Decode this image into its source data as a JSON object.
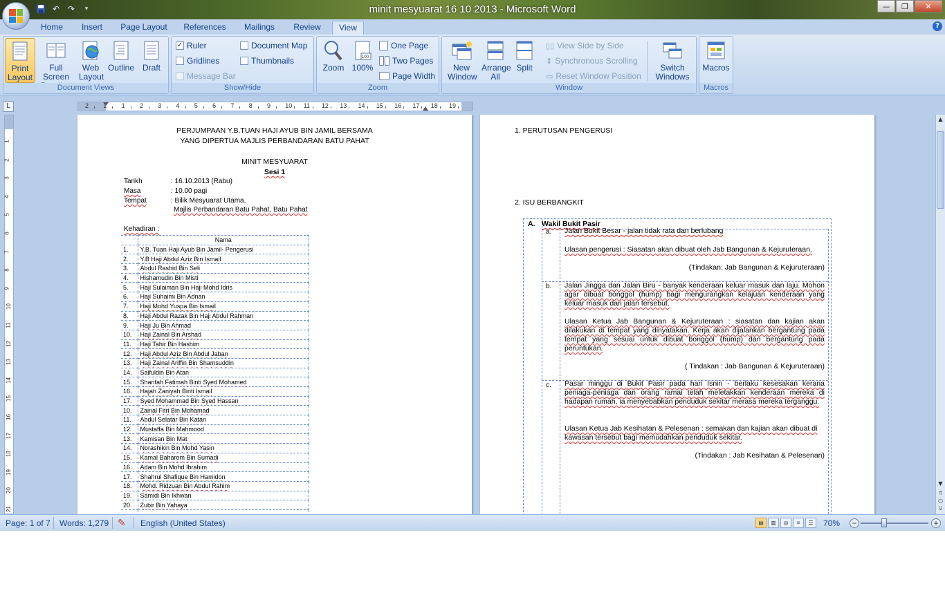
{
  "window": {
    "title": "minit mesyuarat 16 10 2013 - Microsoft Word"
  },
  "quick_access": {
    "save_icon": "save-icon",
    "undo_icon": "undo-icon",
    "redo_icon": "redo-icon",
    "customize_icon": "chevron-down-icon"
  },
  "tabs": [
    {
      "label": "Home"
    },
    {
      "label": "Insert"
    },
    {
      "label": "Page Layout"
    },
    {
      "label": "References"
    },
    {
      "label": "Mailings"
    },
    {
      "label": "Review"
    },
    {
      "label": "View",
      "active": true
    }
  ],
  "ribbon": {
    "document_views": {
      "label": "Document Views",
      "print_layout": "Print Layout",
      "full_screen_reading": "Full Screen Reading",
      "web_layout": "Web Layout",
      "outline": "Outline",
      "draft": "Draft"
    },
    "show_hide": {
      "label": "Show/Hide",
      "ruler": "Ruler",
      "ruler_checked": true,
      "gridlines": "Gridlines",
      "gridlines_checked": false,
      "message_bar": "Message Bar",
      "message_bar_enabled": false,
      "document_map": "Document Map",
      "document_map_checked": false,
      "thumbnails": "Thumbnails",
      "thumbnails_checked": false
    },
    "zoom": {
      "label": "Zoom",
      "zoom": "Zoom",
      "hundred": "100%",
      "one_page": "One Page",
      "two_pages": "Two Pages",
      "page_width": "Page Width"
    },
    "window": {
      "label": "Window",
      "new_window": "New Window",
      "arrange_all": "Arrange All",
      "split": "Split",
      "view_side_by_side": "View Side by Side",
      "synchronous_scrolling": "Synchronous Scrolling",
      "reset_window_position": "Reset Window Position",
      "switch_windows": "Switch Windows"
    },
    "macros": {
      "label": "Macros",
      "macros": "Macros"
    }
  },
  "ruler": {
    "numbers": [
      "2",
      "1",
      "1",
      "2",
      "3",
      "4",
      "5",
      "6",
      "7",
      "8",
      "9",
      "10",
      "11",
      "12",
      "13",
      "14",
      "15",
      "16",
      "17",
      "18",
      "19"
    ],
    "vertical_numbers": [
      "1",
      "2",
      "3",
      "4",
      "5",
      "6",
      "7",
      "8",
      "9",
      "10",
      "11",
      "12",
      "13",
      "14",
      "15",
      "16",
      "17",
      "18",
      "19",
      "20",
      "21"
    ]
  },
  "page1": {
    "heading1": "PERJUMPAAN Y.B.TUAN HAJI AYUB BIN JAMIL BERSAMA",
    "heading2": "YANG DIPERTUA  MAJLIS PERBANDARAN BATU PAHAT",
    "title": "MINIT MESYUARAT",
    "session": "Sesi 1",
    "tarikh_label": "Tarikh",
    "tarikh_value": ": 16.10.2013  (Rabu)",
    "masa_label": "Masa",
    "masa_value": ": 10.00 pagi",
    "tempat_label": "Tempat",
    "tempat_value1": ": Bilik Mesyuarat  Utama,",
    "tempat_value2": "Majlis Perbandaran Batu Pahat, Batu Pahat",
    "kehadiran_label": "Kehadiran :",
    "table_header": "Nama",
    "attendees": [
      [
        "1.",
        "Y.B. Tuan Haji Ayub Bin Jamil-  Pengerusi"
      ],
      [
        "2.",
        "Y.B Haji Abdul Aziz Bin Ismail"
      ],
      [
        "3.",
        "Abdul Rashid Bin Seli"
      ],
      [
        "4.",
        "Hishamudin Bin Misti"
      ],
      [
        "5.",
        "Haji Sulaiman Bin Haji Mohd Idris"
      ],
      [
        "6.",
        "Haji Suhaimi Bin Adnan"
      ],
      [
        "7.",
        "Haji Mohd Yuspa Bin Ismail"
      ],
      [
        "8.",
        "Haji Abdul Razak Bin Haji Abdul Rahman"
      ],
      [
        "9.",
        "Haji Ju Bin Ahmad"
      ],
      [
        "10.",
        "Haji Zainal Bin Arshad"
      ],
      [
        "11.",
        "Haji Tahir Bin Hashim"
      ],
      [
        "12.",
        "Haji Abdul Aziz Bin Abdul Jaban"
      ],
      [
        "13.",
        "Haji Zainal Ariffin Bin Shamsuddin"
      ],
      [
        "14.",
        "Saifuldin Bin Atan"
      ],
      [
        "15.",
        "Sharifah Fatimah  Binti Syed Mohamed"
      ],
      [
        "16.",
        "Hajah Zaniyah Binti Ismail"
      ],
      [
        "17.",
        "Syed Mohammad  Bin Syed Hassan"
      ],
      [
        "10.",
        "Zainal Fitri Bin Mohamad"
      ],
      [
        "11.",
        "Abdul Selatar Bin Katan"
      ],
      [
        "12.",
        "Mustaffa Bin Mahmood"
      ],
      [
        "13.",
        "Kamisan Bin Mat"
      ],
      [
        "14.",
        "Norashikin Bin Mohd Yasin"
      ],
      [
        "15.",
        "Kamal Baharom Bin Sumadi"
      ],
      [
        "16.",
        "Adam Bin Mohd Ibrahim"
      ],
      [
        "17.",
        "Shahrul Shafique Bin Hamidon"
      ],
      [
        "18.",
        "Mohd. Ridzuan Bin Abdul Rahim"
      ],
      [
        "19.",
        "Samidi Bin Ikhwan"
      ],
      [
        "20.",
        "Zubir Bin Yahaya"
      ],
      [
        "",
        ""
      ]
    ]
  },
  "page2": {
    "section1": "1.   PERUTUSAN PENGERUSI",
    "section2": "2.   ISU BERBANGKIT",
    "item_a_label": "A.",
    "item_a_title": "Wakil Bukit Pasir",
    "sub_a": "a.",
    "sub_a_text": "Jalan Bukit Besar - jalan tidak rata  dan berlubang",
    "sub_a_ulasan": "Ulasan pengerusi : Siasatan akan dibuat oleh Jab Bangunan & Kejuruteraan.",
    "sub_a_tindakan": "(Tindakan: Jab Bangunan & Kejuruteraan)",
    "sub_b": "b.",
    "sub_b_text": "Jalan Jingga dan Jalan Biru - banyak kenderaan keluar masuk dan laju. Mohon agar dibuat bonggol (hump) bagi mengurangkan kelajuan kenderaan yang keluar masuk dari jalan tersebut.",
    "sub_b_ulasan": "Ulasan Ketua Jab Bangunan & Kejuruteraan : siasatan dan kajian akan dilakukan di tempat yang dinyatakan.  Kerja akan dijalankan bergantung pada tempat yang sesuai untuk dibuat bonggol (hump) dan bergantung pada peruntukan.",
    "sub_b_tindakan": "( Tindakan : Jab Bangunan & Kejuruteraan)",
    "sub_c": "c.",
    "sub_c_text": "Pasar minggu di Bukit Pasir pada hari Isnin - berlaku kesesakan kerana peniaga-peniaga dan orang ramai telah meletakkan kenderaan mereka di hadapan rumah, ia menyebabkan penduduk sekitar merasa mereka terganggu.",
    "sub_c_ulasan": "Ulasan Ketua Jab Kesihatan & Pelesenan  : semakan dan kajian akan dibuat di kawasan tersebut bagi memudahkan penduduk sekitar.",
    "sub_c_tindakan": "(Tindakan :  Jab Kesihatan  & Pelesenan)"
  },
  "statusbar": {
    "page": "Page: 1 of 7",
    "words": "Words: 1,279",
    "proofing_icon": "proofing-error-icon",
    "language": "English (United States)",
    "zoom": "70%",
    "zoom_level": 0.7
  },
  "colors": {
    "ribbon_text": "#15428b",
    "ribbon_bg": "#dfe9f5",
    "doc_bg": "#b8cde8",
    "spell_error": "#e03030"
  }
}
